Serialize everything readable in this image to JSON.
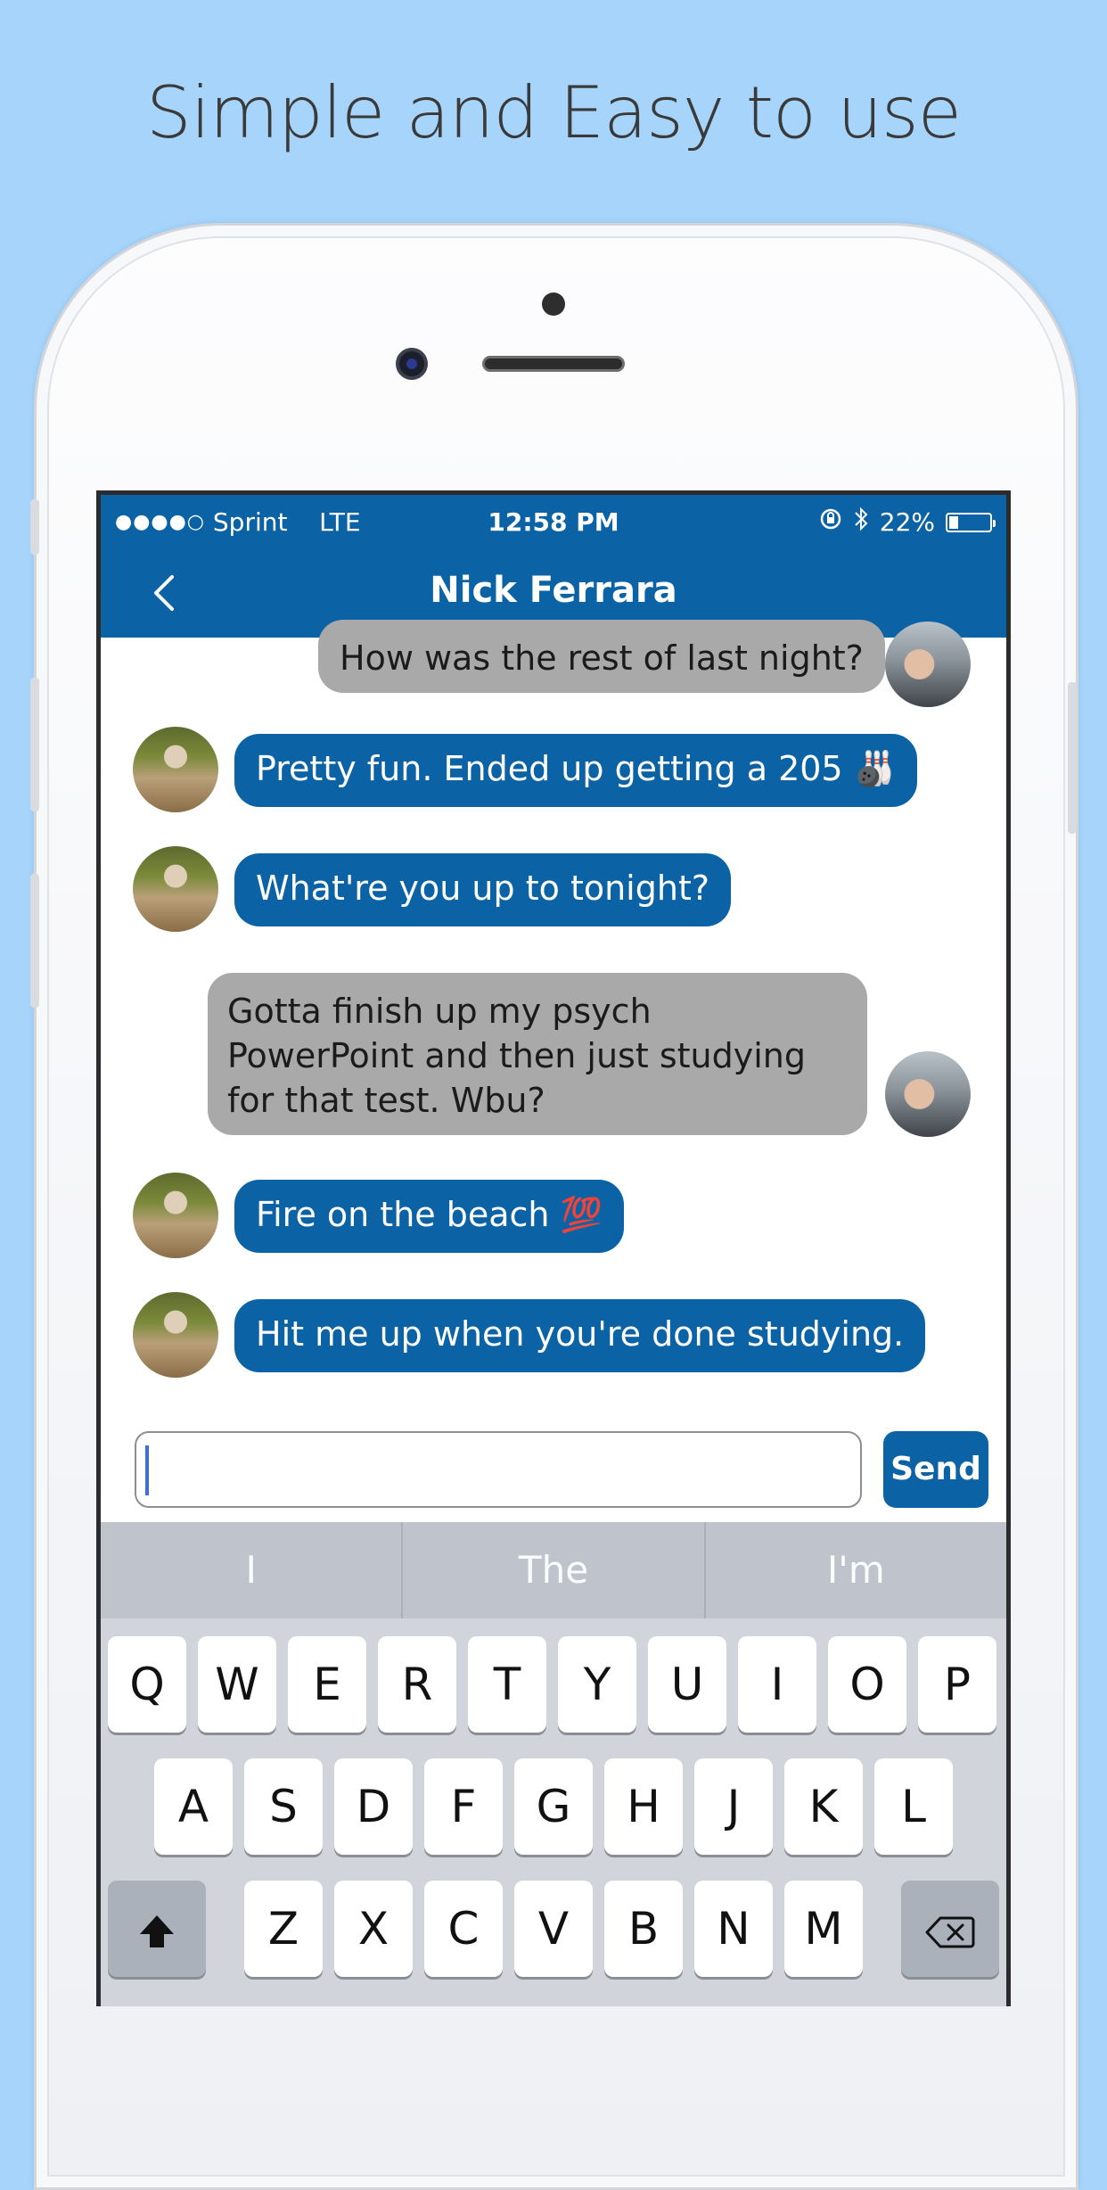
{
  "headline": "Simple and Easy to use",
  "status_bar": {
    "carrier": "Sprint",
    "network": "LTE",
    "time": "12:58 PM",
    "battery": "22%"
  },
  "nav": {
    "title": "Nick Ferrara"
  },
  "messages": [
    {
      "sender": "me",
      "text": "How was the rest of last night?"
    },
    {
      "sender": "friend",
      "text": "Pretty fun. Ended up getting a 205 🎳"
    },
    {
      "sender": "friend",
      "text": "What're you up to tonight?"
    },
    {
      "sender": "me",
      "text": "Gotta finish up my psych PowerPoint and then just studying for that test. Wbu?"
    },
    {
      "sender": "friend",
      "text": "Fire on the beach 💯"
    },
    {
      "sender": "friend",
      "text": "Hit me up when you're done studying."
    }
  ],
  "composer": {
    "value": "",
    "send_label": "Send"
  },
  "keyboard": {
    "suggestions": [
      "I",
      "The",
      "I'm"
    ],
    "row1": [
      "Q",
      "W",
      "E",
      "R",
      "T",
      "Y",
      "U",
      "I",
      "O",
      "P"
    ],
    "row2": [
      "A",
      "S",
      "D",
      "F",
      "G",
      "H",
      "J",
      "K",
      "L"
    ],
    "row3": [
      "Z",
      "X",
      "C",
      "V",
      "B",
      "N",
      "M"
    ]
  },
  "colors": {
    "background": "#a6d4fa",
    "accent": "#0b63a6",
    "outgoing_bubble": "#a9a9a9"
  }
}
